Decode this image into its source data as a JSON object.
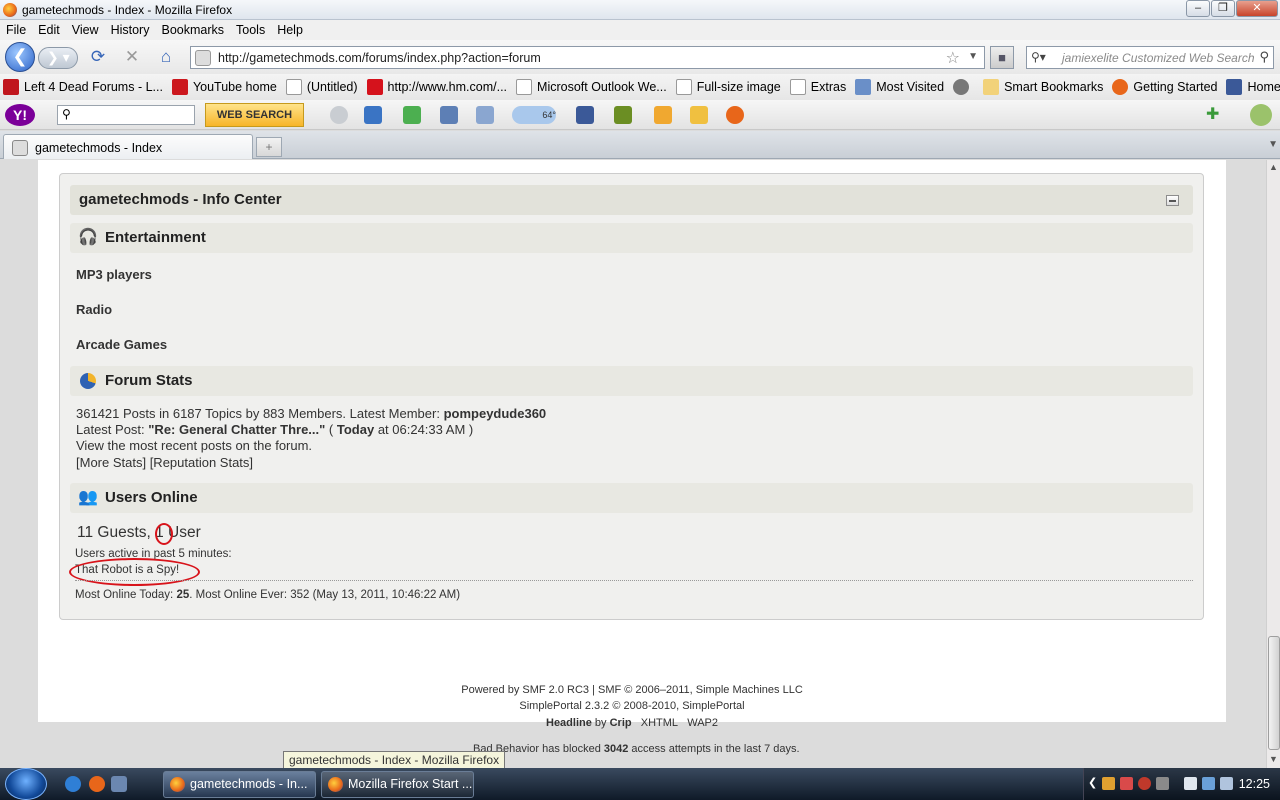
{
  "window": {
    "title": "gametechmods - Index - Mozilla Firefox"
  },
  "menu": [
    "File",
    "Edit",
    "View",
    "History",
    "Bookmarks",
    "Tools",
    "Help"
  ],
  "nav": {
    "url": "http://gametechmods.com/forums/index.php?action=forum",
    "search_placeholder": "jamiexelite Customized Web Search"
  },
  "bookmarks": [
    {
      "label": "Left 4 Dead Forums - L...",
      "color": "#c0161d"
    },
    {
      "label": "YouTube home",
      "color": "#cc181e"
    },
    {
      "label": "(Untitled)",
      "color": "#ffffff"
    },
    {
      "label": "http://www.hm.com/...",
      "color": "#d5121c"
    },
    {
      "label": "Microsoft Outlook We...",
      "color": "#ffffff"
    },
    {
      "label": "Full-size image",
      "color": "#ffffff"
    },
    {
      "label": "Extras",
      "color": "#ffffff"
    },
    {
      "label": "Most Visited",
      "color": "#6a8fc8"
    },
    {
      "label": "",
      "color": "#777777"
    },
    {
      "label": "Smart Bookmarks",
      "color": "#f2d27a"
    },
    {
      "label": "Getting Started",
      "color": "#e8661a"
    },
    {
      "label": "Home",
      "color": "#3b5998"
    }
  ],
  "yahoo": {
    "logo": "Y!",
    "search_button": "WEB SEARCH",
    "weather": "64°"
  },
  "tab": {
    "label": "gametechmods - Index",
    "new_tab": "+"
  },
  "info_center": {
    "title": "gametechmods - Info Center",
    "entertainment": {
      "heading": "Entertainment",
      "links": [
        "MP3 players",
        "Radio",
        "Arcade Games"
      ]
    },
    "forum_stats": {
      "heading": "Forum Stats",
      "stats_text": "361421 Posts in 6187 Topics by 883 Members. Latest Member: ",
      "latest_member": "pompeydude360",
      "latest_post_label": "Latest Post: ",
      "latest_post_title": "\"Re: General Chatter Thre...\"",
      "latest_post_open": " ( ",
      "latest_post_day": "Today",
      "latest_post_time": " at 06:24:33 AM )",
      "recent_posts": "View the most recent posts on the forum.",
      "more_stats": "[More Stats] [Reputation Stats]"
    },
    "users_online": {
      "heading": "Users Online",
      "guests": "11 Guests, 1 User",
      "active_label": "Users active in past 5 minutes:",
      "active_user": "That Robot is a Spy!",
      "most_online_today_label": "Most Online Today: ",
      "most_online_today": "25",
      "most_online_ever": ". Most Online Ever: 352 (May 13, 2011, 10:46:22 AM)"
    }
  },
  "footer": {
    "powered": "Powered by SMF 2.0 RC3 | SMF © 2006–2011, Simple Machines LLC",
    "portal": "SimplePortal 2.3.2 © 2008-2010, SimplePortal",
    "theme_name": "Headline",
    "theme_by": " by ",
    "theme_author": "Crip",
    "xhtml": "XHTML",
    "wap2": "WAP2",
    "bad_behavior_pre": "Bad Behavior has blocked ",
    "bad_behavior_count": "3042",
    "bad_behavior_post": " access attempts in the last 7 days."
  },
  "tooltip": "gametechmods - Index - Mozilla Firefox",
  "taskbar": {
    "tasks": [
      "gametechmods - In...",
      "Mozilla Firefox Start ..."
    ],
    "clock": "12:25"
  },
  "colors": {
    "annotation_red": "#d8131a",
    "yahoo_purple": "#7b0099"
  }
}
